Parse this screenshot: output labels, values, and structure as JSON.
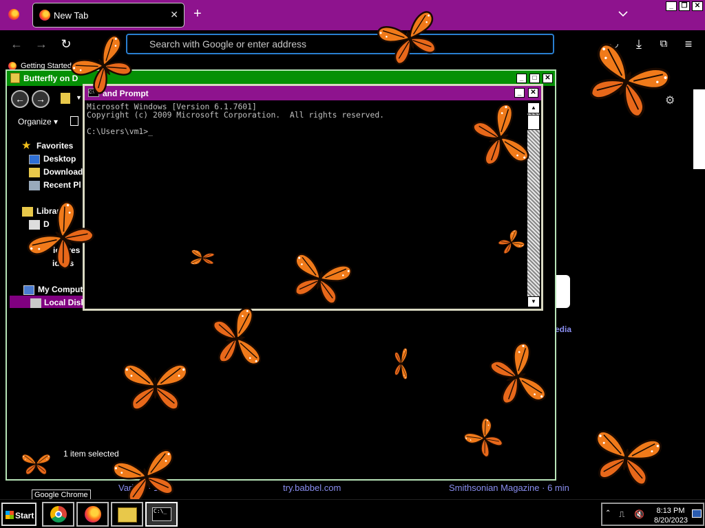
{
  "browser": {
    "tab_title": "New Tab",
    "url_placeholder": "Search with Google or enter address",
    "bookmark": "Getting Started",
    "bottom_links": [
      "Variety · 1",
      "try.babbel.com",
      "Smithsonian Magazine · 6 min"
    ],
    "side_link": "edia"
  },
  "explorer": {
    "title": "Butterfly on D",
    "organize": "Organize",
    "favorites": "Favorites",
    "desktop": "Desktop",
    "downloads": "Download",
    "recent": "Recent Pl",
    "libraries": "Libraries",
    "lib_d": "D",
    "pictures": "ictures",
    "videos": "ideos",
    "computer": "My Compute",
    "local_disk": "Local Disk",
    "status": "1 item selected"
  },
  "cmd": {
    "title": "and Prompt",
    "line1": "Microsoft Windows [Version 6.1.7601]",
    "line2": "Copyright (c) 2009 Microsoft Corporation.  All rights reserved.",
    "line3": "C:\\Users\\vm1>_"
  },
  "taskbar": {
    "start": "Start",
    "tooltip": "Google Chrome",
    "time": "8:13 PM",
    "date": "8/20/2023",
    "cmd_icon_text": "C:\\_"
  },
  "colors": {
    "tab_bar": "#8e138e",
    "explorer_title": "#059005",
    "cmd_title": "#8e138e",
    "butterfly_orange": "#f07a1a",
    "url_border": "#2a7fd1"
  }
}
